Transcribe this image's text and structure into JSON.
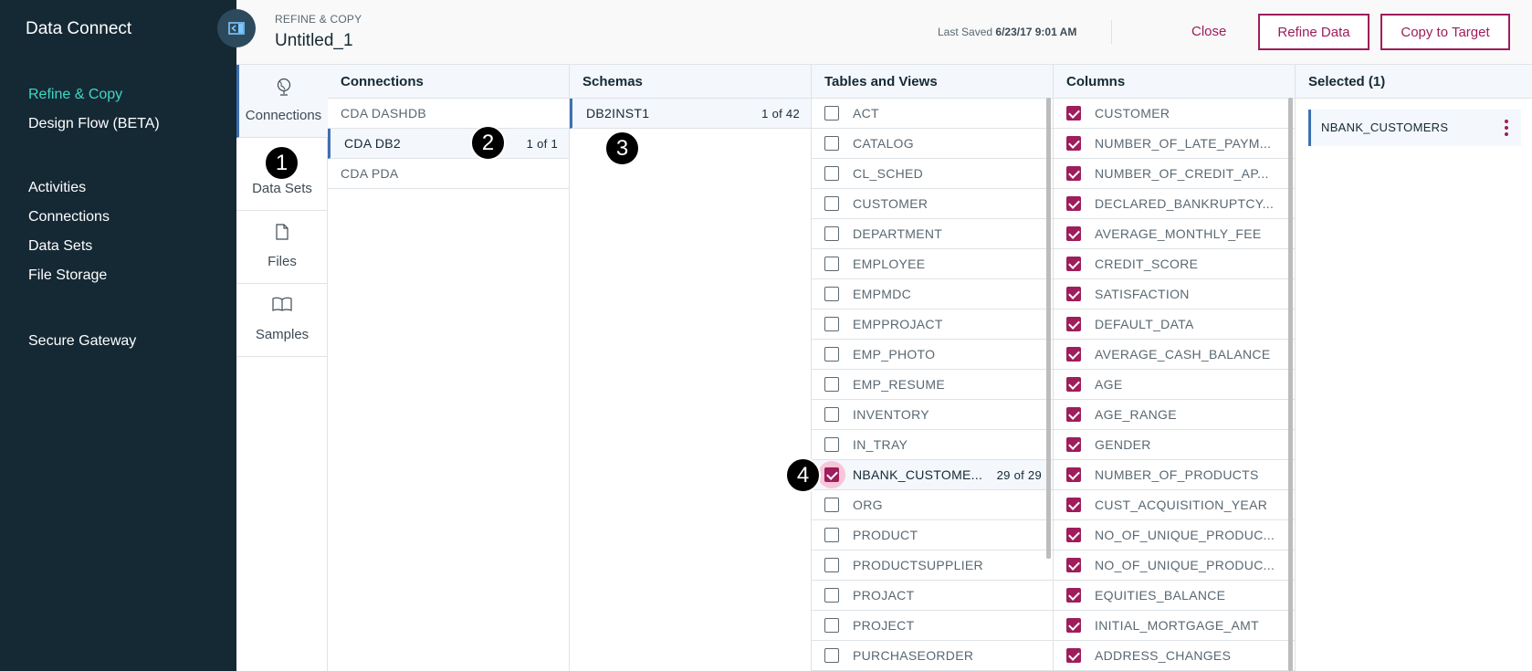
{
  "nav": {
    "title": "Data Connect",
    "items": [
      {
        "label": "Refine & Copy",
        "active": true
      },
      {
        "label": "Design Flow (BETA)",
        "active": false
      },
      {
        "label": "Activities",
        "active": false
      },
      {
        "label": "Connections",
        "active": false
      },
      {
        "label": "Data Sets",
        "active": false
      },
      {
        "label": "File Storage",
        "active": false
      },
      {
        "label": "Secure Gateway",
        "active": false
      }
    ]
  },
  "header": {
    "breadcrumb": "REFINE & COPY",
    "title": "Untitled_1",
    "last_saved_label": "Last Saved",
    "last_saved_value": "6/23/17 9:01 AM",
    "close_label": "Close",
    "refine_label": "Refine Data",
    "copy_label": "Copy to Target"
  },
  "source_tabs": [
    {
      "label": "Connections",
      "icon": "globe-icon",
      "active": true
    },
    {
      "label": "Data Sets",
      "icon": "data-sets-icon",
      "active": false
    },
    {
      "label": "Files",
      "icon": "file-icon",
      "active": false
    },
    {
      "label": "Samples",
      "icon": "book-icon",
      "active": false
    }
  ],
  "connections": {
    "header": "Connections",
    "items": [
      {
        "label": "CDA DASHDB",
        "count": "",
        "selected": false
      },
      {
        "label": "CDA DB2",
        "count": "1 of 1",
        "selected": true
      },
      {
        "label": "CDA PDA",
        "count": "",
        "selected": false
      }
    ]
  },
  "schemas": {
    "header": "Schemas",
    "items": [
      {
        "label": "DB2INST1",
        "count": "1 of 42",
        "selected": true
      }
    ]
  },
  "tables": {
    "header": "Tables and Views",
    "items": [
      {
        "label": "ACT",
        "checked": false,
        "count": ""
      },
      {
        "label": "CATALOG",
        "checked": false,
        "count": ""
      },
      {
        "label": "CL_SCHED",
        "checked": false,
        "count": ""
      },
      {
        "label": "CUSTOMER",
        "checked": false,
        "count": ""
      },
      {
        "label": "DEPARTMENT",
        "checked": false,
        "count": ""
      },
      {
        "label": "EMPLOYEE",
        "checked": false,
        "count": ""
      },
      {
        "label": "EMPMDC",
        "checked": false,
        "count": ""
      },
      {
        "label": "EMPPROJACT",
        "checked": false,
        "count": ""
      },
      {
        "label": "EMP_PHOTO",
        "checked": false,
        "count": ""
      },
      {
        "label": "EMP_RESUME",
        "checked": false,
        "count": ""
      },
      {
        "label": "INVENTORY",
        "checked": false,
        "count": ""
      },
      {
        "label": "IN_TRAY",
        "checked": false,
        "count": ""
      },
      {
        "label": "NBANK_CUSTOME...",
        "checked": true,
        "count": "29 of 29"
      },
      {
        "label": "ORG",
        "checked": false,
        "count": ""
      },
      {
        "label": "PRODUCT",
        "checked": false,
        "count": ""
      },
      {
        "label": "PRODUCTSUPPLIER",
        "checked": false,
        "count": ""
      },
      {
        "label": "PROJACT",
        "checked": false,
        "count": ""
      },
      {
        "label": "PROJECT",
        "checked": false,
        "count": ""
      },
      {
        "label": "PURCHASEORDER",
        "checked": false,
        "count": ""
      }
    ]
  },
  "columns": {
    "header": "Columns",
    "items": [
      {
        "label": "CUSTOMER",
        "checked": true
      },
      {
        "label": "NUMBER_OF_LATE_PAYM...",
        "checked": true
      },
      {
        "label": "NUMBER_OF_CREDIT_AP...",
        "checked": true
      },
      {
        "label": "DECLARED_BANKRUPTCY...",
        "checked": true
      },
      {
        "label": "AVERAGE_MONTHLY_FEE",
        "checked": true
      },
      {
        "label": "CREDIT_SCORE",
        "checked": true
      },
      {
        "label": "SATISFACTION",
        "checked": true
      },
      {
        "label": "DEFAULT_DATA",
        "checked": true
      },
      {
        "label": "AVERAGE_CASH_BALANCE",
        "checked": true
      },
      {
        "label": "AGE",
        "checked": true
      },
      {
        "label": "AGE_RANGE",
        "checked": true
      },
      {
        "label": "GENDER",
        "checked": true
      },
      {
        "label": "NUMBER_OF_PRODUCTS",
        "checked": true
      },
      {
        "label": "CUST_ACQUISITION_YEAR",
        "checked": true
      },
      {
        "label": "NO_OF_UNIQUE_PRODUC...",
        "checked": true
      },
      {
        "label": "NO_OF_UNIQUE_PRODUC...",
        "checked": true
      },
      {
        "label": "EQUITIES_BALANCE",
        "checked": true
      },
      {
        "label": "INITIAL_MORTGAGE_AMT",
        "checked": true
      },
      {
        "label": "ADDRESS_CHANGES",
        "checked": true
      }
    ]
  },
  "selected": {
    "header": "Selected (1)",
    "items": [
      {
        "label": "NBANK_CUSTOMERS"
      }
    ]
  },
  "markers": [
    "1",
    "2",
    "3",
    "4"
  ],
  "colors": {
    "nav_bg": "#152935",
    "accent_magenta": "#9e1d5b",
    "active_teal": "#41d6c3",
    "selection_blue": "#3d70b2"
  }
}
